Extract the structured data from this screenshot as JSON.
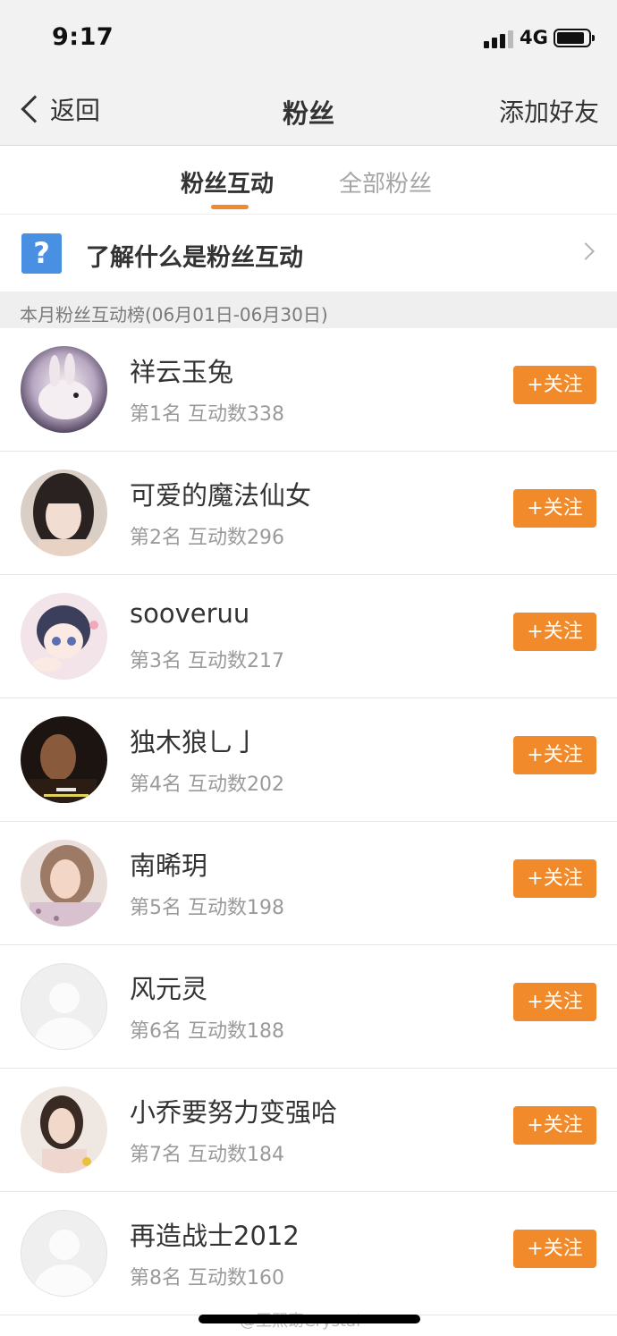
{
  "status_bar": {
    "time": "9:17",
    "network": "4G"
  },
  "nav": {
    "back_label": "返回",
    "title": "粉丝",
    "add_friend": "添加好友"
  },
  "tabs": [
    {
      "label": "粉丝互动",
      "active": true
    },
    {
      "label": "全部粉丝",
      "active": false
    }
  ],
  "info": {
    "icon": "question-icon",
    "text": "了解什么是粉丝互动"
  },
  "section_title": "本月粉丝互动榜(06月01日-06月30日)",
  "follow_label": "+关注",
  "fans": [
    {
      "name": "祥云玉兔",
      "stat": "第1名 互动数338"
    },
    {
      "name": "可爱的魔法仙女",
      "stat": "第2名 互动数296"
    },
    {
      "name": "sooveruu",
      "stat": "第3名 互动数217"
    },
    {
      "name": "独木狼乚亅",
      "stat": "第4名 互动数202"
    },
    {
      "name": "南晞玥",
      "stat": "第5名 互动数198"
    },
    {
      "name": "风元灵",
      "stat": "第6名 互动数188"
    },
    {
      "name": "小乔要努力变强哈",
      "stat": "第7名 互动数184"
    },
    {
      "name": "再造战士2012",
      "stat": "第8名 互动数160"
    }
  ],
  "watermark": "@王熙窈Crystal",
  "colors": {
    "accent": "#f08a2b",
    "info_icon": "#4a90e2",
    "nav_bg": "#f2f2f2"
  }
}
